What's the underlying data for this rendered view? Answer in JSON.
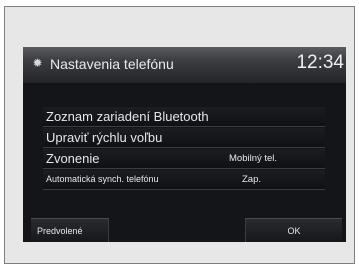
{
  "header": {
    "icon": "gear-icon",
    "title": "Nastavenia telefónu",
    "clock": "12:34"
  },
  "menu": {
    "items": [
      {
        "label": "Zoznam zariadení Bluetooth",
        "value": ""
      },
      {
        "label": "Upraviť rýchlu voľbu",
        "value": ""
      },
      {
        "label": "Zvonenie",
        "value": "Mobilný tel."
      },
      {
        "label": "Automatická synch. telefónu",
        "value": "Zap."
      }
    ]
  },
  "footer": {
    "default_label": "Predvolené",
    "ok_label": "OK"
  },
  "colors": {
    "frame_background": "#e7e7e7",
    "screen_background": "#141518",
    "text": "#e6e7e9"
  }
}
